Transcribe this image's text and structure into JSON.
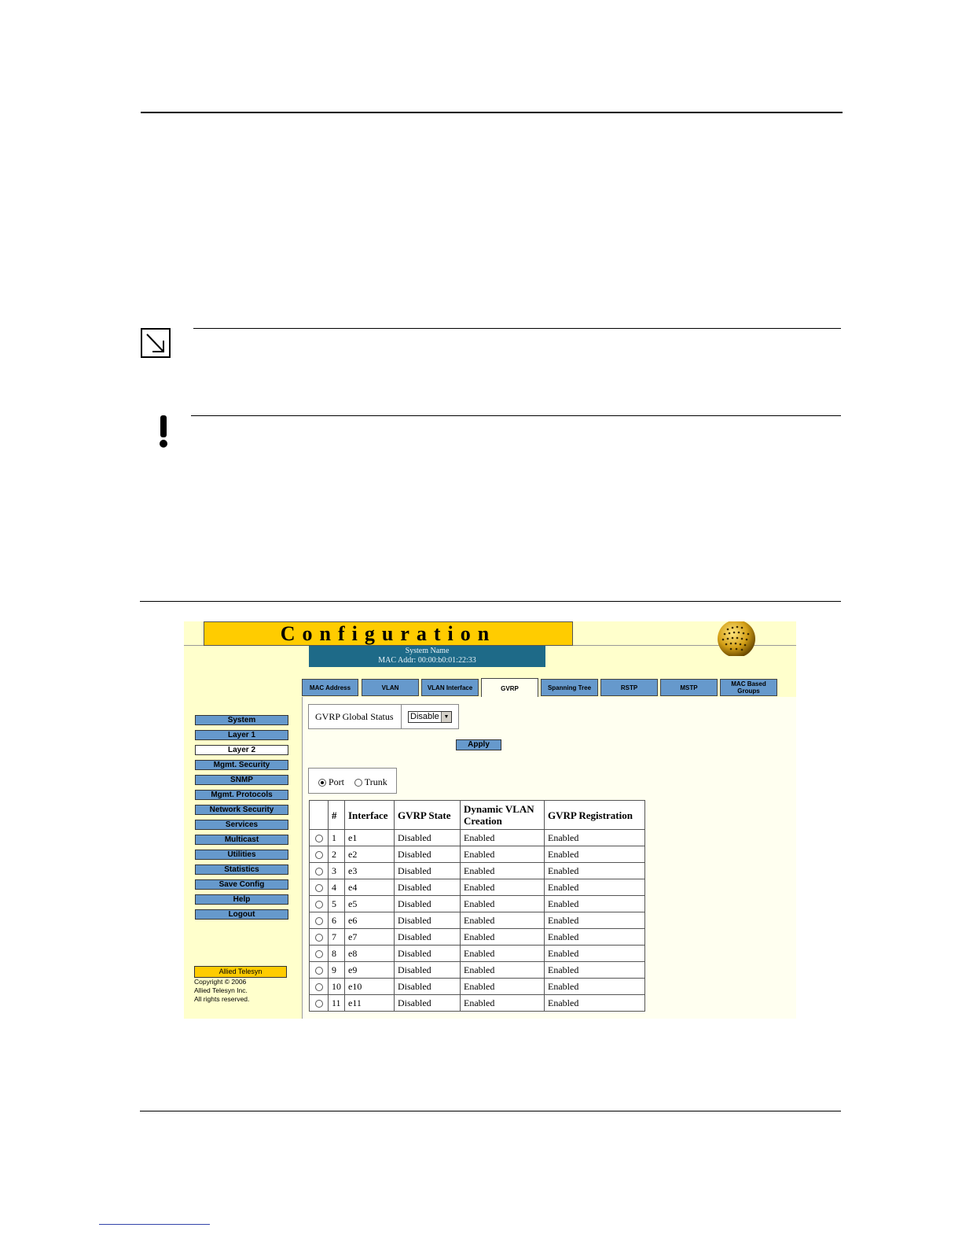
{
  "screenshot": {
    "title": "Configuration",
    "system_name": "System Name",
    "mac_addr": "MAC Addr:  00:00:b0:01:22:33",
    "tabs": [
      {
        "label": "MAC Address"
      },
      {
        "label": "VLAN"
      },
      {
        "label": "VLAN Interface"
      },
      {
        "label": "GVRP",
        "active": true
      },
      {
        "label": "Spanning Tree"
      },
      {
        "label": "RSTP"
      },
      {
        "label": "MSTP"
      },
      {
        "label": "MAC Based Groups"
      }
    ],
    "sidebar": [
      {
        "label": "System"
      },
      {
        "label": "Layer 1"
      },
      {
        "label": "Layer 2",
        "active": true
      },
      {
        "label": "Mgmt. Security"
      },
      {
        "label": "SNMP"
      },
      {
        "label": "Mgmt. Protocols"
      },
      {
        "label": "Network Security"
      },
      {
        "label": "Services"
      },
      {
        "label": "Multicast"
      },
      {
        "label": "Utilities"
      },
      {
        "label": "Statistics"
      },
      {
        "label": "Save Config"
      },
      {
        "label": "Help"
      },
      {
        "label": "Logout"
      }
    ],
    "logo": "Allied Telesyn",
    "copyright": [
      "Copyright © 2006",
      "Allied Telesyn Inc.",
      "All rights reserved."
    ],
    "gvrp_global_status_label": "GVRP Global Status",
    "gvrp_global_status_value": "Disable",
    "apply_label": "Apply",
    "port_label": "Port",
    "trunk_label": "Trunk",
    "table": {
      "headers": [
        "",
        "#",
        "Interface",
        "GVRP State",
        "Dynamic VLAN Creation",
        "GVRP Registration"
      ],
      "rows": [
        [
          "1",
          "e1",
          "Disabled",
          "Enabled",
          "Enabled"
        ],
        [
          "2",
          "e2",
          "Disabled",
          "Enabled",
          "Enabled"
        ],
        [
          "3",
          "e3",
          "Disabled",
          "Enabled",
          "Enabled"
        ],
        [
          "4",
          "e4",
          "Disabled",
          "Enabled",
          "Enabled"
        ],
        [
          "5",
          "e5",
          "Disabled",
          "Enabled",
          "Enabled"
        ],
        [
          "6",
          "e6",
          "Disabled",
          "Enabled",
          "Enabled"
        ],
        [
          "7",
          "e7",
          "Disabled",
          "Enabled",
          "Enabled"
        ],
        [
          "8",
          "e8",
          "Disabled",
          "Enabled",
          "Enabled"
        ],
        [
          "9",
          "e9",
          "Disabled",
          "Enabled",
          "Enabled"
        ],
        [
          "10",
          "e10",
          "Disabled",
          "Enabled",
          "Enabled"
        ],
        [
          "11",
          "e11",
          "Disabled",
          "Enabled",
          "Enabled"
        ]
      ]
    }
  }
}
